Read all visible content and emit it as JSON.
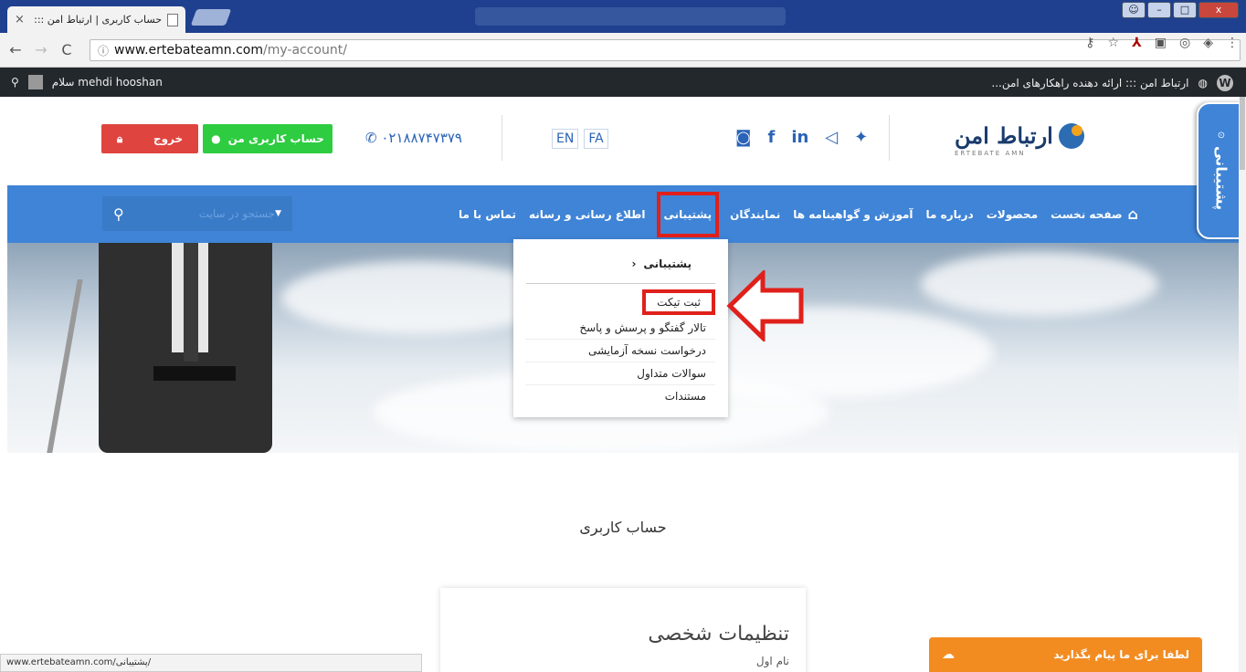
{
  "browser": {
    "tab_title": "حساب کاربری | ارتباط امن ::: ا",
    "tab_close": "×",
    "url_host": "www.ertebateamn.com",
    "url_path": "/my-account/",
    "status_url": "www.ertebateamn.com/پشتیبانی/"
  },
  "adminbar": {
    "greeting": "سلام mehdi hooshan",
    "site_name": "ارتباط امن ::: ارائه دهنده راهکارهای امن..."
  },
  "header": {
    "logo_text": "ارتباط امن",
    "logo_sub": "ERTEBATE AMN",
    "social": [
      "f",
      "in"
    ],
    "lang": [
      "EN",
      "FA"
    ],
    "phone": "۰۲۱۸۸۷۴۷۳۷۹",
    "account_button": "حساب کاربری من",
    "exit_button": "خروج"
  },
  "nav": {
    "items": [
      "صفحه نخست",
      "محصولات",
      "درباره ما",
      "آموزش و گواهینامه ها",
      "نمایندگان",
      "پشتیبانی",
      "اطلاع رسانی و رسانه",
      "تماس با ما"
    ],
    "active_index": 5,
    "search_placeholder": "جستجو در سایت"
  },
  "side_tab": {
    "label": "پشتیبانی"
  },
  "dropdown": {
    "heading": "پشتیبانی",
    "items": [
      "ثبت تیکت",
      "تالار گفتگو و پرسش و پاسخ",
      "درخواست نسخه آزمایشی",
      "سوالات متداول",
      "مستندات"
    ],
    "highlighted_index": 0
  },
  "content": {
    "section_title": "حساب کاربری",
    "card_title": "تنظیمات شخصی",
    "card_field": "نام اول"
  },
  "chat": {
    "label": "لطفا برای ما پیام بگذارید"
  },
  "colors": {
    "nav_blue": "#3f84d6",
    "highlight_red": "#e0201b",
    "account_green": "#2ecc40",
    "exit_red": "#e0443f",
    "chat_orange": "#f28c21",
    "adminbar": "#23282d"
  }
}
